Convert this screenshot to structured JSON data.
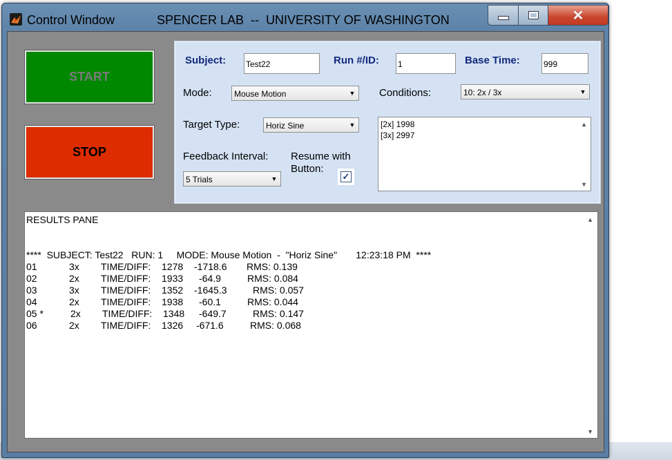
{
  "window": {
    "title": "Control Window",
    "lab_title": "SPENCER LAB  --  UNIVERSITY OF WASHINGTON",
    "close_glyph": "✕"
  },
  "controls": {
    "start_label": "START",
    "stop_label": "STOP"
  },
  "settings": {
    "subject_label": "Subject:",
    "subject_value": "Test22",
    "run_label": "Run #/ID:",
    "run_value": "1",
    "base_time_label": "Base Time:",
    "base_time_value": "999",
    "mode_label": "Mode:",
    "mode_value": "Mouse Motion",
    "conditions_label": "Conditions:",
    "conditions_value": "10: 2x / 3x",
    "target_type_label": "Target Type:",
    "target_type_value": "Horiz Sine",
    "feedback_label": "Feedback Interval:",
    "feedback_value": "5 Trials",
    "resume_label_1": "Resume with",
    "resume_label_2": "Button:",
    "resume_checked": true,
    "conditions_list": [
      "[2x] 1998",
      "[3x] 2997"
    ]
  },
  "results": {
    "heading": "RESULTS PANE",
    "header_line": "****  SUBJECT: Test22   RUN: 1     MODE: Mouse Motion  -  \"Horiz Sine\"       12:23:18 PM  ****",
    "rows": [
      {
        "trial": "01",
        "cond": "3x",
        "label": "TIME/DIFF:",
        "time": "1278",
        "diff": "-1718.6",
        "rms": "RMS: 0.139"
      },
      {
        "trial": "02",
        "cond": "2x",
        "label": "TIME/DIFF:",
        "time": "1933",
        "diff": "-64.9",
        "rms": "RMS: 0.084"
      },
      {
        "trial": "03",
        "cond": "3x",
        "label": "TIME/DIFF:",
        "time": "1352",
        "diff": "-1645.3",
        "rms": "RMS: 0.057"
      },
      {
        "trial": "04",
        "cond": "2x",
        "label": "TIME/DIFF:",
        "time": "1938",
        "diff": "-60.1",
        "rms": "RMS: 0.044"
      },
      {
        "trial": "05 *",
        "cond": "2x",
        "label": "TIME/DIFF:",
        "time": "1348",
        "diff": "-649.7",
        "rms": "RMS: 0.147"
      },
      {
        "trial": "06",
        "cond": "2x",
        "label": "TIME/DIFF:",
        "time": "1326",
        "diff": "-671.6",
        "rms": "RMS: 0.068"
      }
    ]
  },
  "colors": {
    "start_bg": "#008800",
    "stop_bg": "#dd2c00",
    "panel_bg": "#d4e2f4",
    "label_blue": "#14287a"
  },
  "icons": [
    "matlab-logo-icon",
    "minimize-icon",
    "maximize-icon",
    "close-icon",
    "dropdown-arrow-icon",
    "checkmark-icon",
    "scroll-up-icon",
    "scroll-down-icon"
  ]
}
